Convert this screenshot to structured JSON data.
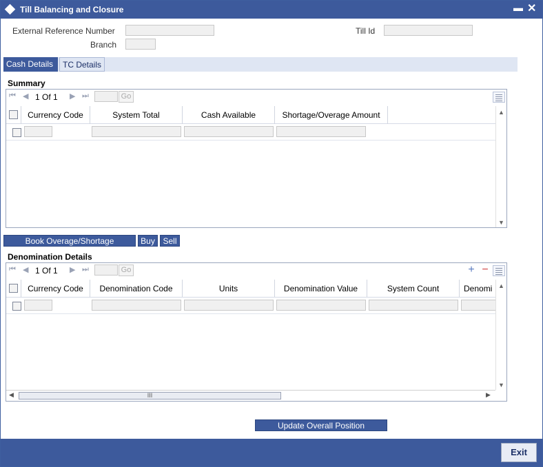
{
  "window": {
    "title": "Till Balancing and Closure",
    "minimize": "▬",
    "close": "✕"
  },
  "form": {
    "ext_ref_label": "External Reference Number",
    "till_id_label": "Till Id",
    "branch_label": "Branch"
  },
  "tabs": [
    {
      "label": "Cash Details",
      "active": true
    },
    {
      "label": "TC Details",
      "active": false
    }
  ],
  "summary": {
    "title": "Summary",
    "pager": {
      "first": "⏮",
      "prev": "◀",
      "page_text": "1 Of 1",
      "next": "▶",
      "last": "⏭",
      "go": "Go"
    },
    "columns": [
      "Currency Code",
      "System Total",
      "Cash Available",
      "Shortage/Overage Amount"
    ]
  },
  "actions": {
    "book": "Book Overage/Shortage",
    "buy": "Buy",
    "sell": "Sell"
  },
  "denomination": {
    "title": "Denomination Details",
    "pager": {
      "first": "⏮",
      "prev": "◀",
      "page_text": "1 Of 1",
      "next": "▶",
      "last": "⏭",
      "go": "Go"
    },
    "add": "+",
    "remove": "−",
    "columns": [
      "Currency Code",
      "Denomination Code",
      "Units",
      "Denomination Value",
      "System Count",
      "Denomi"
    ],
    "hscroll_grip": "III"
  },
  "update_button": "Update Overall Position",
  "exit_button": "Exit",
  "colors": {
    "accent": "#3d5a9c"
  }
}
